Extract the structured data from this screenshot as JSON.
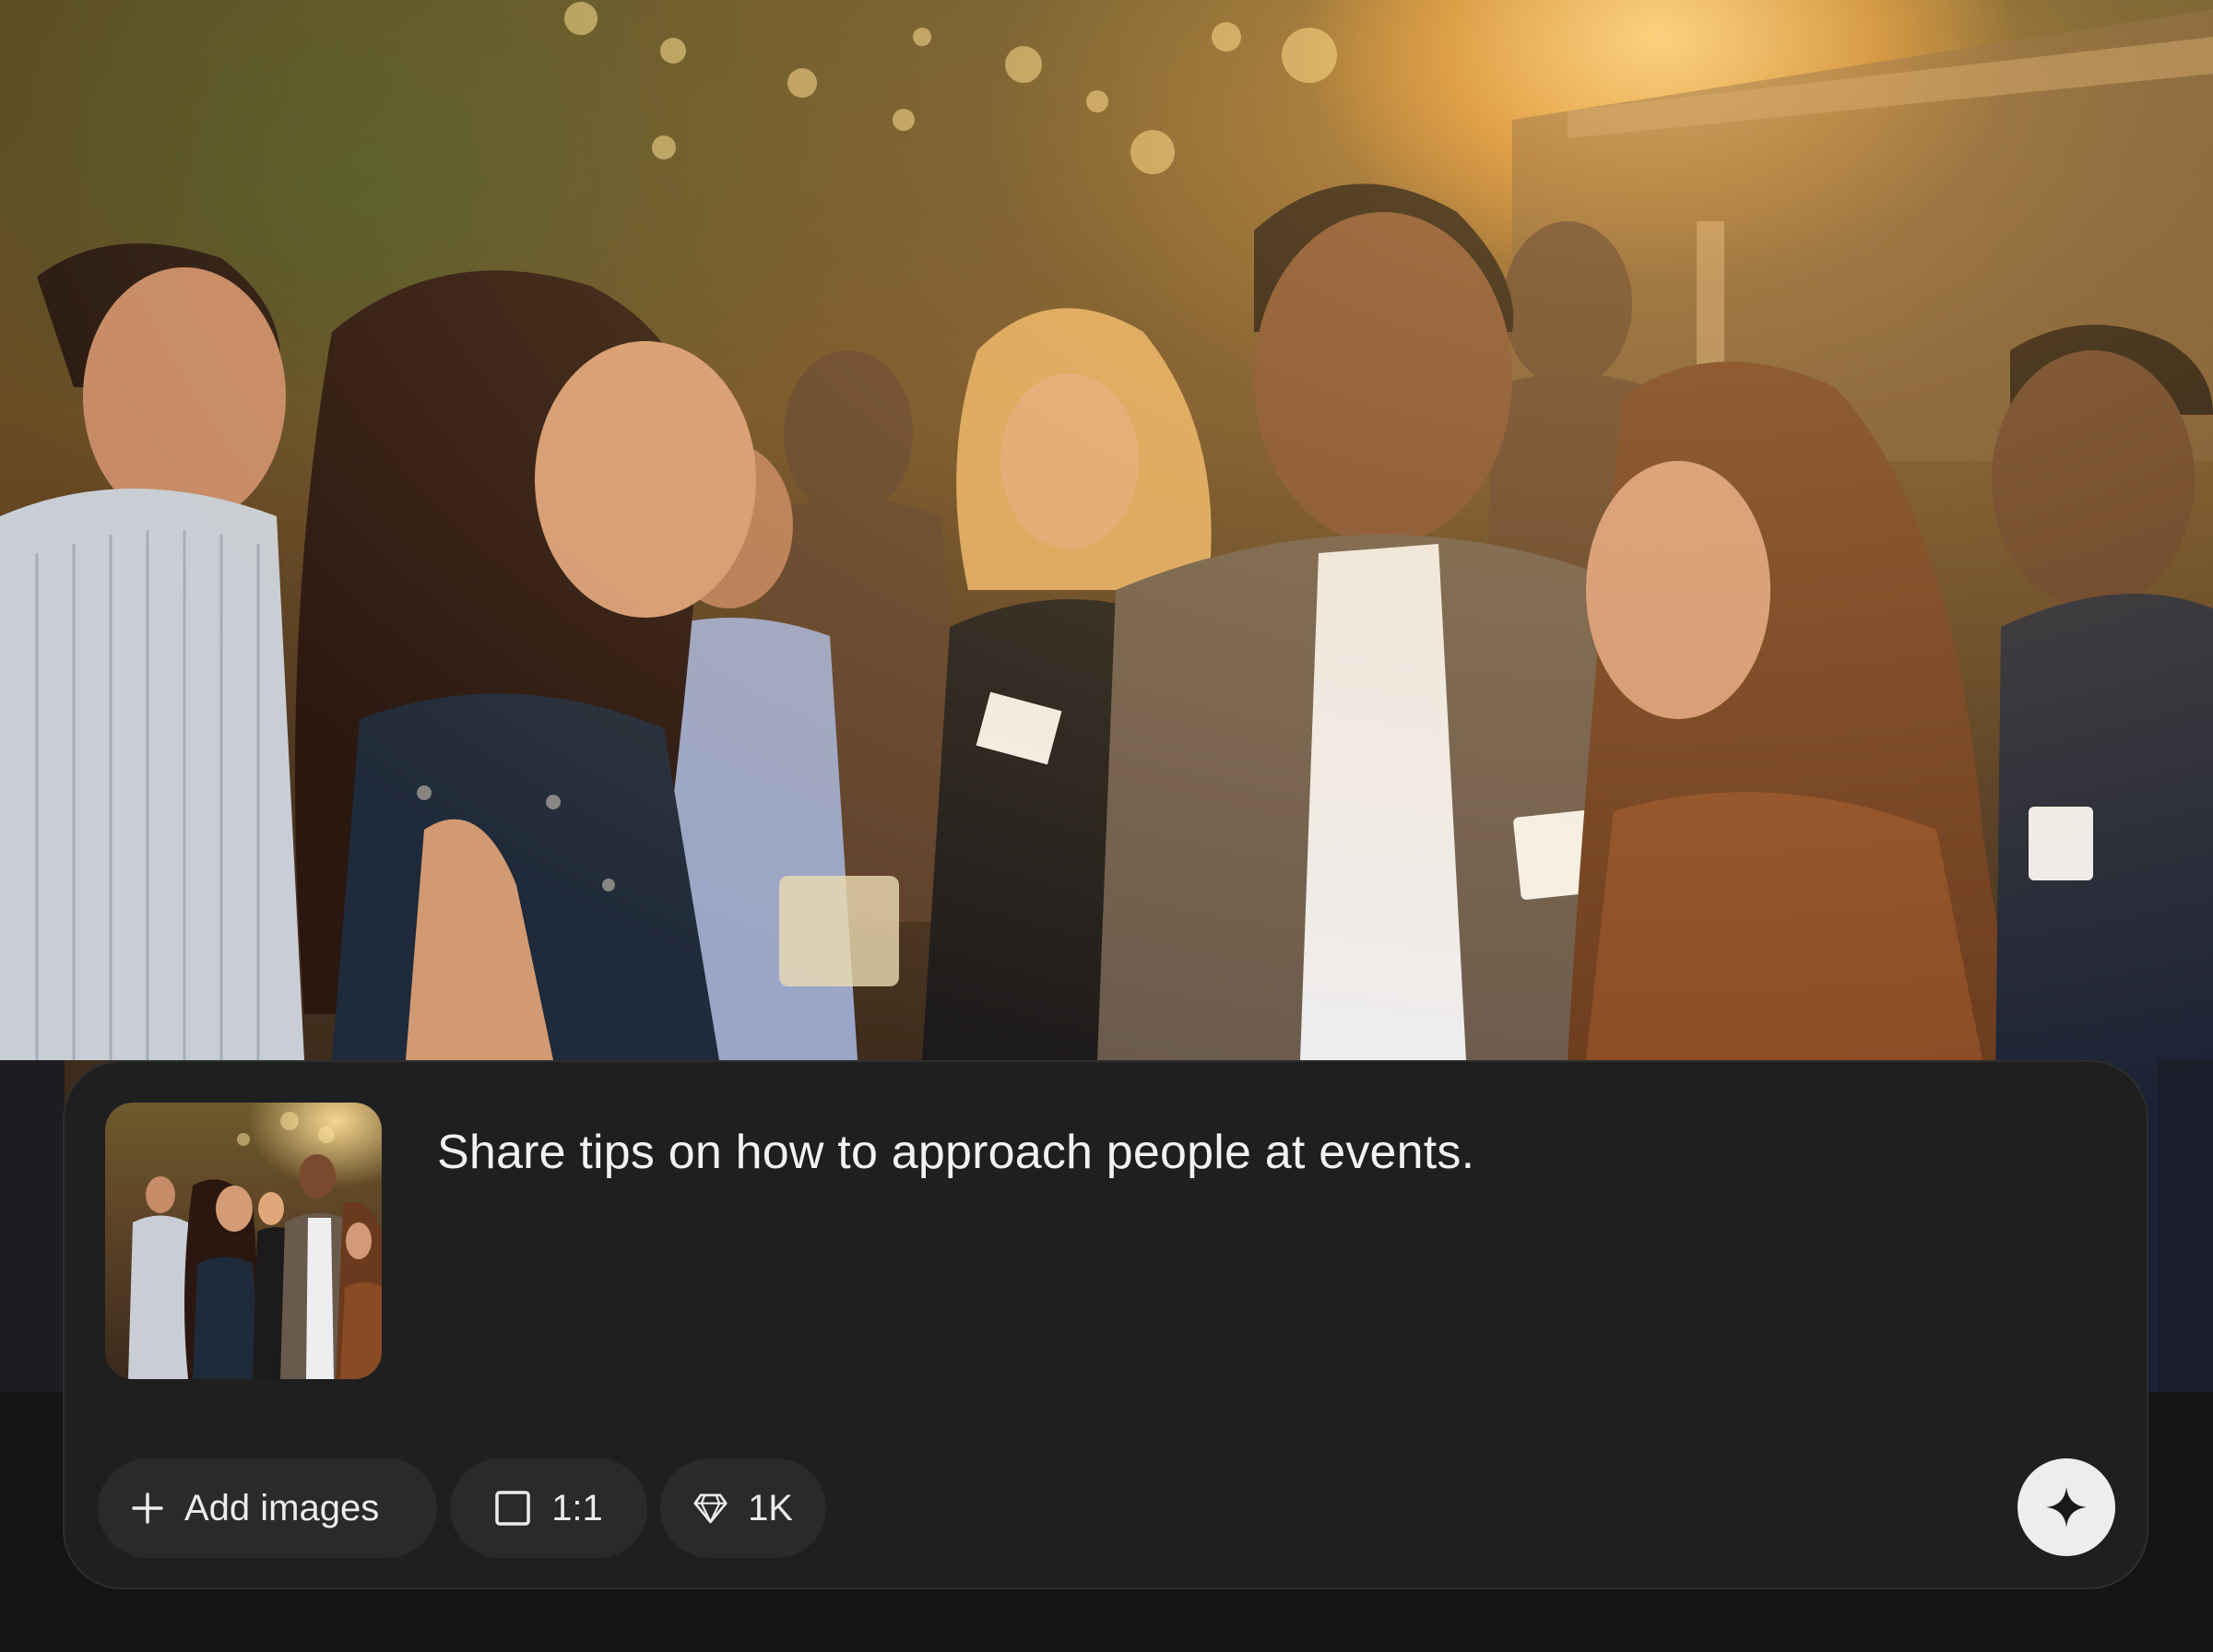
{
  "composer": {
    "prompt_text": "Share tips on how to approach people at events.",
    "toolbar": {
      "add_images_label": "Add images",
      "aspect_ratio_label": "1:1",
      "resolution_label": "1K"
    },
    "icons": {
      "add": "plus-icon",
      "aspect_ratio": "square-icon",
      "resolution": "diamond-icon",
      "send": "sparkle-icon"
    }
  },
  "colors": {
    "panel_bg": "#1f1f1f",
    "chip_bg": "#2a2a2a",
    "send_bg": "#ededed",
    "text": "#f2f2f2"
  }
}
